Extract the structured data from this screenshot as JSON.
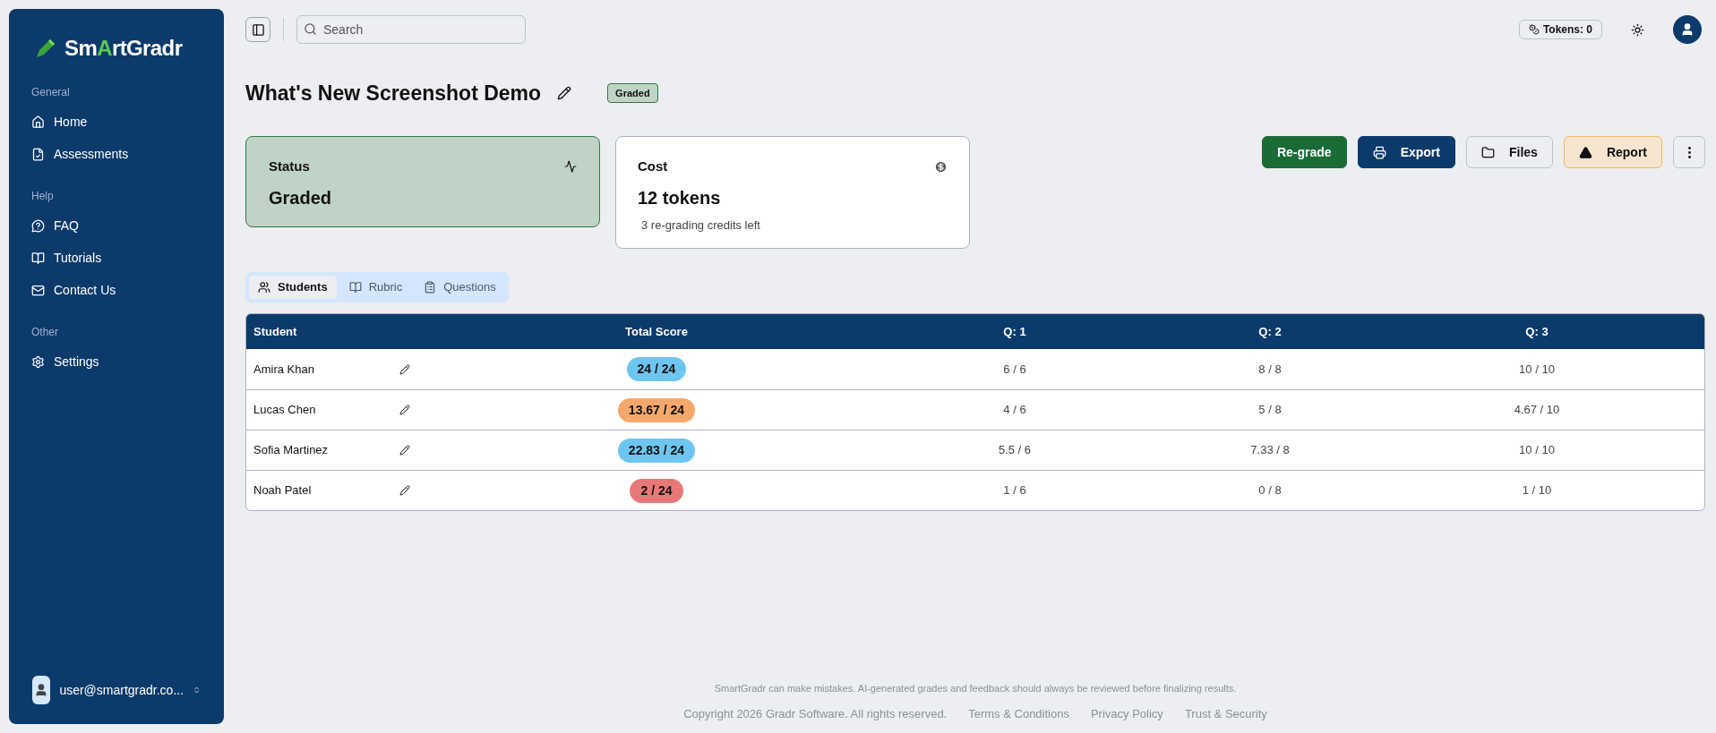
{
  "sidebar": {
    "logo": [
      "Sm",
      "A",
      "rtGradr"
    ],
    "sections": [
      {
        "title": "General",
        "items": [
          {
            "label": "Home",
            "kind": "home"
          },
          {
            "label": "Assessments",
            "kind": "assessments"
          }
        ]
      },
      {
        "title": "Help",
        "items": [
          {
            "label": "FAQ",
            "kind": "faq"
          },
          {
            "label": "Tutorials",
            "kind": "tutorials"
          },
          {
            "label": "Contact Us",
            "kind": "contact"
          }
        ]
      },
      {
        "title": "Other",
        "items": [
          {
            "label": "Settings",
            "kind": "settings"
          }
        ]
      }
    ],
    "user": {
      "email": "user@smartgradr.co..."
    }
  },
  "topbar": {
    "search": {
      "placeholder": "Search"
    },
    "tokens": "Tokens: 0"
  },
  "page": {
    "title": "What's New Screenshot Demo",
    "status_badge": "Graded"
  },
  "cards": [
    {
      "kind": "status",
      "label": "Status",
      "value": "Graded"
    },
    {
      "kind": "cost",
      "label": "Cost",
      "value": "12 tokens",
      "note": "3 re-grading credits left"
    }
  ],
  "actions": [
    {
      "kind": "regrade",
      "label": "Re-grade"
    },
    {
      "kind": "export",
      "label": "Export"
    },
    {
      "kind": "files",
      "label": "Files"
    },
    {
      "kind": "report",
      "label": "Report"
    }
  ],
  "tabs": [
    {
      "label": "Students",
      "kind": "students",
      "selected": true
    },
    {
      "label": "Rubric",
      "kind": "rubric",
      "selected": false
    },
    {
      "label": "Questions",
      "kind": "questions",
      "selected": false
    }
  ],
  "table": {
    "columns": [
      "Student",
      "Total Score",
      "Q: 1",
      "Q: 2",
      "Q: 3"
    ],
    "rows": [
      {
        "student": "Amira Khan",
        "total": "24 / 24",
        "color": "#6ec6f0",
        "q": [
          "6 / 6",
          "8 / 8",
          "10 / 10"
        ]
      },
      {
        "student": "Lucas Chen",
        "total": "13.67 / 24",
        "color": "#f5a86b",
        "q": [
          "4 / 6",
          "5 / 8",
          "4.67 / 10"
        ]
      },
      {
        "student": "Sofia Martinez",
        "total": "22.83 / 24",
        "color": "#6ec6f0",
        "q": [
          "5.5 / 6",
          "7.33 / 8",
          "10 / 10"
        ]
      },
      {
        "student": "Noah Patel",
        "total": "2 / 24",
        "color": "#e87878",
        "q": [
          "1 / 6",
          "0 / 8",
          "1 / 10"
        ]
      }
    ]
  },
  "footer": {
    "disclaimer": "SmartGradr can make mistakes. AI-generated grades and feedback should always be reviewed before finalizing results.",
    "copyright": "Copyright 2026 Gradr Software. All rights reserved.",
    "links": [
      "Terms & Conditions",
      "Privacy Policy",
      "Trust & Security"
    ]
  }
}
